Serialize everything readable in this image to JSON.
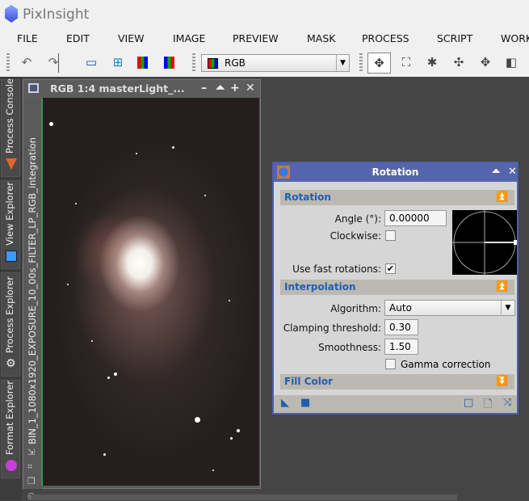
{
  "app": {
    "title": "PixInsight"
  },
  "menu": [
    "FILE",
    "EDIT",
    "VIEW",
    "IMAGE",
    "PREVIEW",
    "MASK",
    "PROCESS",
    "SCRIPT",
    "WORK"
  ],
  "toolbar": {
    "channel_select": "RGB"
  },
  "side_tabs": [
    "Process Console",
    "View Explorer",
    "Process Explorer",
    "Format Explorer"
  ],
  "image_window": {
    "title": "RGB 1:4 masterLight_...",
    "vertical_id": "BIN_1_1080x1920_EXPOSURE_10_00s_FILTER_LP_RGB_integration"
  },
  "rotation": {
    "title": "Rotation",
    "sections": {
      "rotation": "Rotation",
      "interpolation": "Interpolation",
      "fill": "Fill Color"
    },
    "angle_label": "Angle (°):",
    "angle_value": "0.00000",
    "clockwise_label": "Clockwise:",
    "clockwise": false,
    "fast_label": "Use fast rotations:",
    "fast": true,
    "algorithm_label": "Algorithm:",
    "algorithm_value": "Auto",
    "clamp_label": "Clamping threshold:",
    "clamp_value": "0.30",
    "smooth_label": "Smoothness:",
    "smooth_value": "1.50",
    "gamma_label": "Gamma correction",
    "gamma": false
  },
  "colors": {
    "dialog_title": "#5565ad",
    "section_text": "#1f5fb0"
  }
}
